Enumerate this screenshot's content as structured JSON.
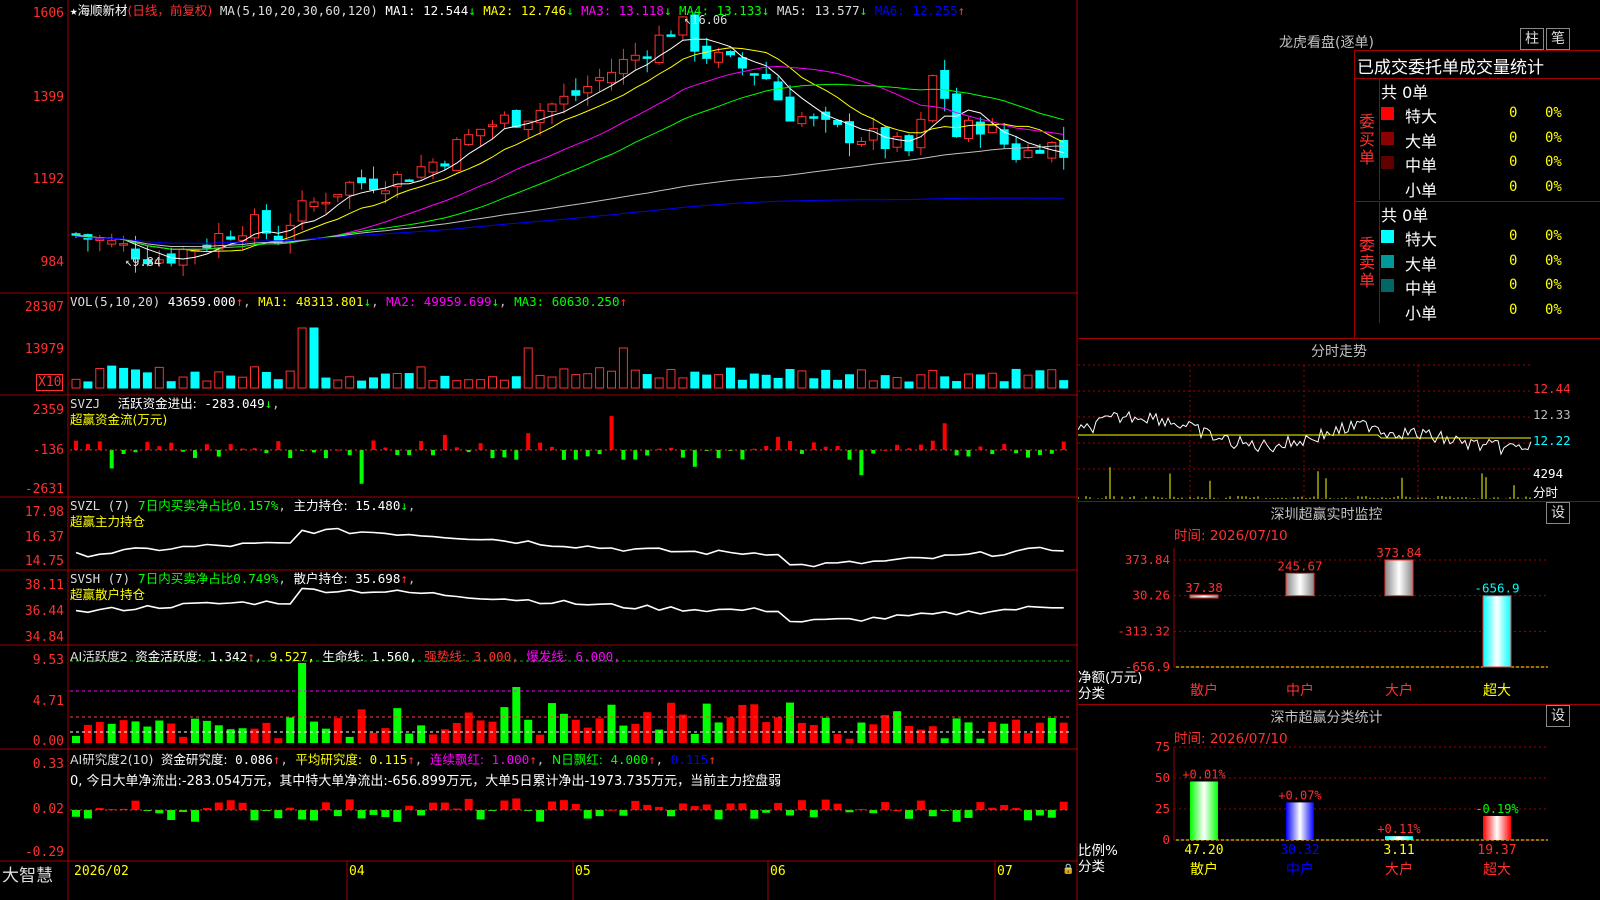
{
  "stock": {
    "star": "★",
    "name": "海顺新材",
    "period": "(日线，前复权)",
    "ma_label": "MA(5,10,20,30,60,120)",
    "ma": [
      {
        "label": "MA1:",
        "value": "12.544",
        "arrow": "↓",
        "color": "#ffffff"
      },
      {
        "label": "MA2:",
        "value": "12.746",
        "arrow": "↓",
        "color": "#ffff00"
      },
      {
        "label": "MA3:",
        "value": "13.118",
        "arrow": "↓",
        "color": "#ff00ff"
      },
      {
        "label": "MA4:",
        "value": "13.133",
        "arrow": "↓",
        "color": "#00ff00"
      },
      {
        "label": "MA5:",
        "value": "13.577",
        "arrow": "↓",
        "color": "#c0c0c0"
      },
      {
        "label": "MA6:",
        "value": "12.255",
        "arrow": "↑",
        "color": "#0000ff"
      }
    ],
    "price_axis": [
      "1606",
      "1399",
      "1192",
      "984"
    ],
    "high_mark": "16.06",
    "low_mark": "9.84"
  },
  "vol": {
    "label": "VOL(5,10,20)",
    "value": "43659.000",
    "arrow": "↑",
    "ma1": "48313.801",
    "ma2": "49959.699",
    "ma3": "60630.250",
    "axis": [
      "28307",
      "13979"
    ],
    "unit": "X10"
  },
  "svzj": {
    "label": "SVZJ",
    "desc": "活跃资金进出:",
    "value": "-283.049",
    "arrow": "↓",
    "sub": "超赢资金流(万元)",
    "axis": [
      "2359",
      "-136",
      "-2631"
    ]
  },
  "svzl": {
    "label": "SVZL (7)",
    "desc": "7日内买卖净占比",
    "ratio": "0.157%",
    "hold_label": "主力持仓:",
    "hold": "15.480",
    "arrow": "↓",
    "sub": "超赢主力持仓",
    "axis": [
      "17.98",
      "16.37",
      "14.75"
    ]
  },
  "svsh": {
    "label": "SVSH (7)",
    "desc": "7日内买卖净占比",
    "ratio": "0.749%",
    "hold_label": "散户持仓:",
    "hold": "35.698",
    "arrow": "↑",
    "sub": "超赢散户持仓",
    "axis": [
      "38.11",
      "36.44",
      "34.84"
    ]
  },
  "ai1": {
    "label": "AI活跃度2",
    "desc": "资金活跃度:",
    "value": "1.342",
    "v2": "9.527,",
    "life_label": "生命线:",
    "life": "1.560,",
    "strong_label": "强势线:",
    "strong": "3.000,",
    "burst_label": "爆发线:",
    "burst": "6.000,",
    "axis": [
      "9.53",
      "4.71",
      "0.00"
    ]
  },
  "ai2": {
    "label": "AI研究度2(10)",
    "desc": "资金研究度:",
    "value": "0.086",
    "avg_label": "平均研究度:",
    "avg": "0.115",
    "red_label": "连续飘红:",
    "red": "1.000",
    "nred_label": "N日飘红:",
    "nred": "4.000",
    "v5": "0.115",
    "note": "0, 今日大单净流出:-283.054万元，其中特大单净流出:-656.899万元，大单5日累计净出-1973.735万元，当前主力控盘弱",
    "axis": [
      "0.33",
      "0.02",
      "-0.29"
    ]
  },
  "xaxis": [
    "2026/02",
    "04",
    "05",
    "06",
    "07"
  ],
  "brand": "大智慧",
  "dragon": {
    "title": "龙虎看盘(逐单)",
    "btn1": "柱",
    "btn2": "笔",
    "header": "已成交委托单成交量统计",
    "buy": {
      "side": "委买单",
      "total": "共 0单",
      "rows": [
        {
          "label": "特大",
          "value": "0",
          "pct": "0%",
          "color": "#ff0000"
        },
        {
          "label": "大单",
          "value": "0",
          "pct": "0%",
          "color": "#8b0000"
        },
        {
          "label": "中单",
          "value": "0",
          "pct": "0%",
          "color": "#600000"
        },
        {
          "label": "小单",
          "value": "0",
          "pct": "0%",
          "color": "#000000"
        }
      ]
    },
    "sell": {
      "side": "委卖单",
      "total": "共 0单",
      "rows": [
        {
          "label": "特大",
          "value": "0",
          "pct": "0%",
          "color": "#00ffff"
        },
        {
          "label": "大单",
          "value": "0",
          "pct": "0%",
          "color": "#009999"
        },
        {
          "label": "中单",
          "value": "0",
          "pct": "0%",
          "color": "#006666"
        },
        {
          "label": "小单",
          "value": "0",
          "pct": "0%",
          "color": "#000000"
        }
      ]
    }
  },
  "intraday": {
    "title": "分时走势",
    "axis": [
      "12.44",
      "12.33",
      "12.22"
    ],
    "vol": "4294",
    "vol_unit": "分时"
  },
  "monitor": {
    "title": "深圳超赢实时监控",
    "btn": "设",
    "time": "时间: 2026/07/10",
    "axis": [
      "373.84",
      "30.26",
      "-313.32",
      "-656.9"
    ],
    "ylabel": "净额(万元)",
    "xlabel": "分类",
    "bars": [
      {
        "cat": "散户",
        "value": 37.38,
        "label": "37.38"
      },
      {
        "cat": "中户",
        "value": 245.67,
        "label": "245.67"
      },
      {
        "cat": "大户",
        "value": 373.84,
        "label": "373.84"
      },
      {
        "cat": "超大",
        "value": -656.9,
        "label": "-656.9"
      }
    ]
  },
  "classify": {
    "title": "深市超赢分类统计",
    "btn": "设",
    "time": "时间: 2026/07/10",
    "axis": [
      "75",
      "50",
      "25",
      "0"
    ],
    "ylabel": "比例%",
    "xlabel": "分类",
    "bars": [
      {
        "cat": "散户",
        "value": 47.2,
        "label": "47.20",
        "chg": "+0.01%"
      },
      {
        "cat": "中户",
        "value": 30.32,
        "label": "30.32",
        "chg": "+0.07%"
      },
      {
        "cat": "大户",
        "value": 3.11,
        "label": "3.11",
        "chg": "+0.11%"
      },
      {
        "cat": "超大",
        "value": 19.37,
        "label": "19.37",
        "chg": "-0.19%"
      }
    ]
  },
  "chart_data": [
    {
      "type": "bar",
      "title": "深圳超赢实时监控",
      "categories": [
        "散户",
        "中户",
        "大户",
        "超大"
      ],
      "values": [
        37.38,
        245.67,
        373.84,
        -656.9
      ],
      "ylabel": "净额(万元)",
      "xlabel": "分类",
      "ylim": [
        -656.9,
        373.84
      ]
    },
    {
      "type": "bar",
      "title": "深市超赢分类统计",
      "categories": [
        "散户",
        "中户",
        "大户",
        "超大"
      ],
      "values": [
        47.2,
        30.32,
        3.11,
        19.37
      ],
      "ylabel": "比例%",
      "xlabel": "分类",
      "ylim": [
        0,
        75
      ]
    }
  ]
}
